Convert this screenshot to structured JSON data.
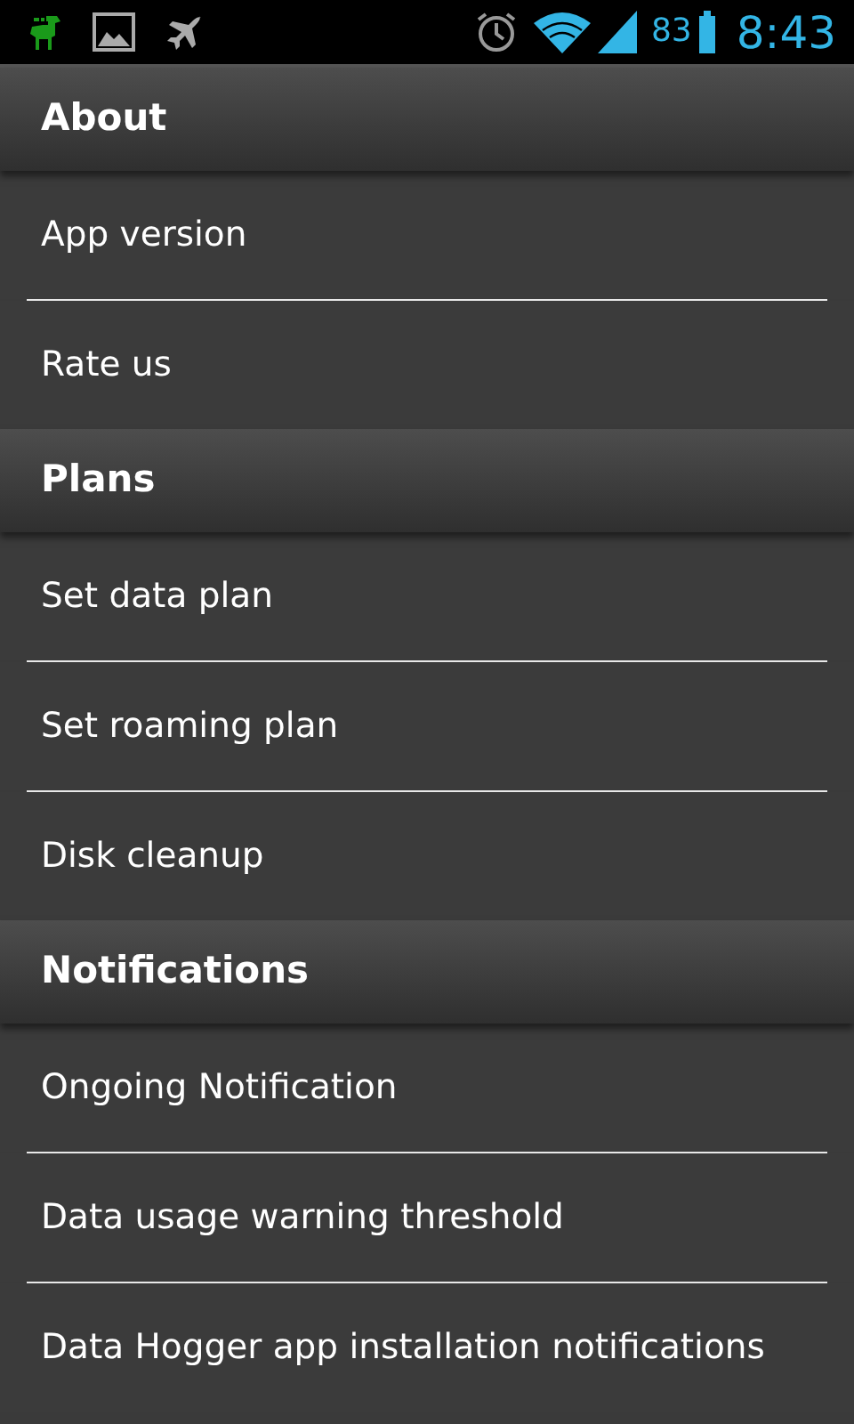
{
  "status_bar": {
    "battery_text": "83",
    "time": "8:43"
  },
  "sections": [
    {
      "title": "About",
      "items": [
        "App version",
        "Rate us"
      ]
    },
    {
      "title": "Plans",
      "items": [
        "Set data plan",
        "Set roaming plan",
        "Disk cleanup"
      ]
    },
    {
      "title": "Notifications",
      "items": [
        "Ongoing Notification",
        "Data usage warning threshold",
        "Data Hogger app installation notifications"
      ]
    }
  ]
}
